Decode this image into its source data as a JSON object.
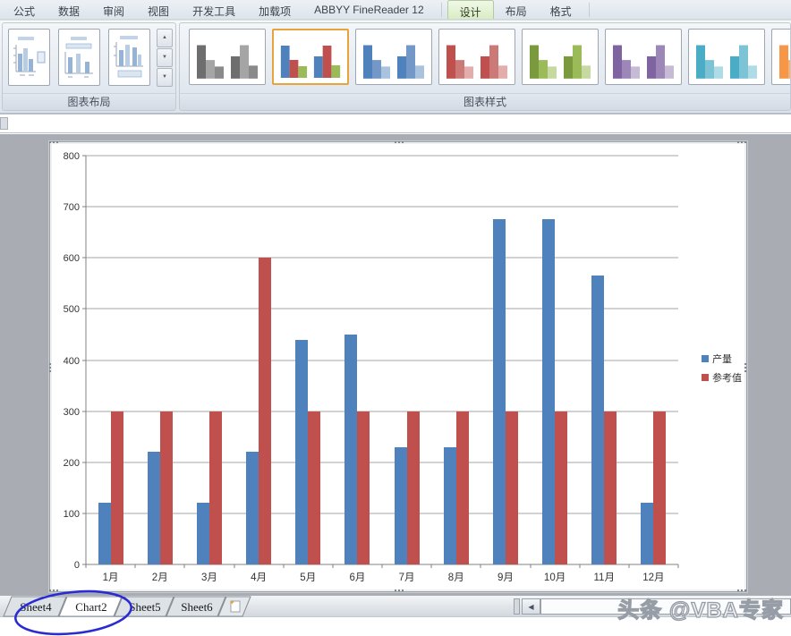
{
  "tabbar": {
    "tabs": [
      {
        "label": "公式",
        "name": "formulas",
        "active": false
      },
      {
        "label": "数据",
        "name": "data",
        "active": false
      },
      {
        "label": "审阅",
        "name": "review",
        "active": false
      },
      {
        "label": "视图",
        "name": "view",
        "active": false
      },
      {
        "label": "开发工具",
        "name": "developer",
        "active": false
      },
      {
        "label": "加载项",
        "name": "add-ins",
        "active": false
      },
      {
        "label": "ABBYY FineReader 12",
        "name": "abbyy-finereader",
        "active": false
      },
      {
        "label": "设计",
        "name": "design",
        "active": true
      },
      {
        "label": "布局",
        "name": "layout",
        "active": false
      },
      {
        "label": "格式",
        "name": "format",
        "active": false
      }
    ]
  },
  "ribbon": {
    "groups": {
      "chart_layouts_label": "图表布局",
      "chart_styles_label": "图表样式"
    },
    "chart_layouts": [
      {
        "name": "chart-layout-1"
      },
      {
        "name": "chart-layout-2"
      },
      {
        "name": "chart-layout-3"
      }
    ],
    "chart_styles": [
      {
        "name": "style-grayscale",
        "selected": false,
        "colors": [
          "#6e6e6e",
          "#a5a5a5",
          "#8a8a8a"
        ]
      },
      {
        "name": "style-multicolor",
        "selected": true,
        "colors": [
          "#4F81BD",
          "#C0504D",
          "#9BBB59"
        ]
      },
      {
        "name": "style-blue",
        "selected": false,
        "colors": [
          "#4F81BD",
          "#7398C7",
          "#A9C2DE"
        ]
      },
      {
        "name": "style-red",
        "selected": false,
        "colors": [
          "#C0504D",
          "#CC7A77",
          "#E2ADAB"
        ]
      },
      {
        "name": "style-green",
        "selected": false,
        "colors": [
          "#7A9A3D",
          "#9BBB59",
          "#C6D9A0"
        ]
      },
      {
        "name": "style-purple",
        "selected": false,
        "colors": [
          "#8064A2",
          "#9C87B8",
          "#C7BAD5"
        ]
      },
      {
        "name": "style-teal",
        "selected": false,
        "colors": [
          "#4BACC6",
          "#7CC3D5",
          "#AFDBE7"
        ]
      },
      {
        "name": "style-orange",
        "selected": false,
        "colors": [
          "#F79646",
          "#F9B075",
          "#FBCCA4"
        ]
      }
    ],
    "selected_style_border": "#E8A33D"
  },
  "chart_data": {
    "type": "bar",
    "categories": [
      "1月",
      "2月",
      "3月",
      "4月",
      "5月",
      "6月",
      "7月",
      "8月",
      "9月",
      "10月",
      "11月",
      "12月"
    ],
    "series": [
      {
        "name": "产量",
        "color": "#4F81BD",
        "values": [
          120,
          220,
          120,
          220,
          440,
          450,
          230,
          230,
          675,
          675,
          565,
          120
        ]
      },
      {
        "name": "参考值",
        "color": "#C0504D",
        "values": [
          300,
          300,
          300,
          600,
          300,
          300,
          300,
          300,
          300,
          300,
          300,
          300
        ]
      }
    ],
    "ylim": [
      0,
      800
    ],
    "ytick_step": 100,
    "grid": true,
    "legend_position": "right",
    "axis_color": "#808080",
    "gridline_color": "#a6a6a6"
  },
  "sheetbar": {
    "tabs": [
      {
        "label": "Sheet4",
        "active": false
      },
      {
        "label": "Chart2",
        "active": true
      },
      {
        "label": "Sheet5",
        "active": false
      },
      {
        "label": "Sheet6",
        "active": false
      }
    ],
    "annotation_color": "#2b2bd2"
  },
  "watermark": {
    "text": "头条 @VBA专家"
  }
}
